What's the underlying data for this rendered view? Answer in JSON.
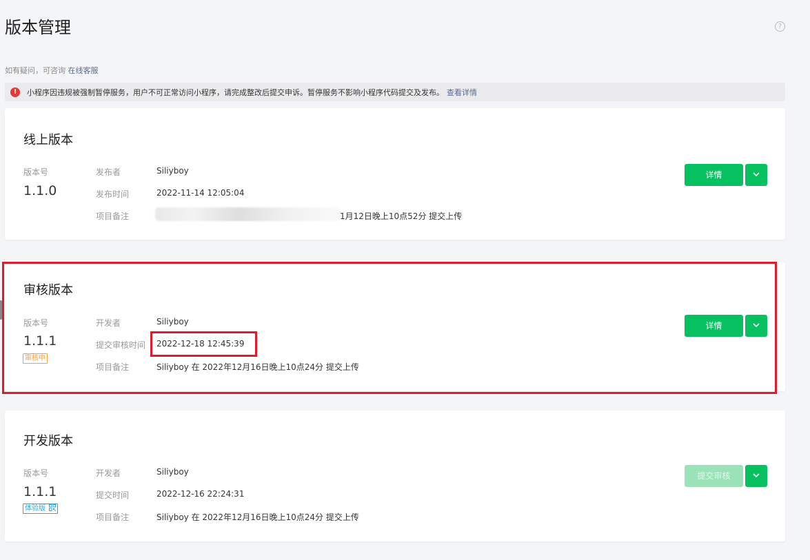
{
  "header": {
    "title": "版本管理",
    "help_icon": "?"
  },
  "contact": {
    "prefix": "如有疑问，可咨询",
    "link": "在线客服"
  },
  "notice": {
    "icon": "!",
    "text": "小程序因违规被强制暂停服务，用户不可正常访问小程序，请完成整改后提交申诉。暂停服务不影响小程序代码提交及发布。",
    "link": "查看详情"
  },
  "online": {
    "title": "线上版本",
    "version_label": "版本号",
    "version": "1.1.0",
    "publisher_label": "发布者",
    "publisher": "Siliyboy",
    "time_label": "发布时间",
    "time": "2022-11-14 12:05:04",
    "note_label": "项目备注",
    "note_visible": "1月12日晚上10点52分 提交上传",
    "button": "详情"
  },
  "review": {
    "title": "审核版本",
    "version_label": "版本号",
    "version": "1.1.1",
    "status": "审核中",
    "developer_label": "开发者",
    "developer": "Siliyboy",
    "time_label": "提交审核时间",
    "time": "2022-12-18 12:45:39",
    "note_label": "项目备注",
    "note": "Siliyboy 在 2022年12月16日晚上10点24分 提交上传",
    "button": "详情"
  },
  "dev": {
    "title": "开发版本",
    "version_label": "版本号",
    "version": "1.1.1",
    "status": "体验版",
    "developer_label": "开发者",
    "developer": "Siliyboy",
    "time_label": "提交时间",
    "time": "2022-12-16 22:24:31",
    "note_label": "项目备注",
    "note": "Siliyboy 在 2022年12月16日晚上10点24分 提交上传",
    "button": "提交审核"
  },
  "colors": {
    "primary": "#07c160",
    "highlight": "#e11b2b",
    "link": "#576b95",
    "warning": "#fa9d3b"
  }
}
